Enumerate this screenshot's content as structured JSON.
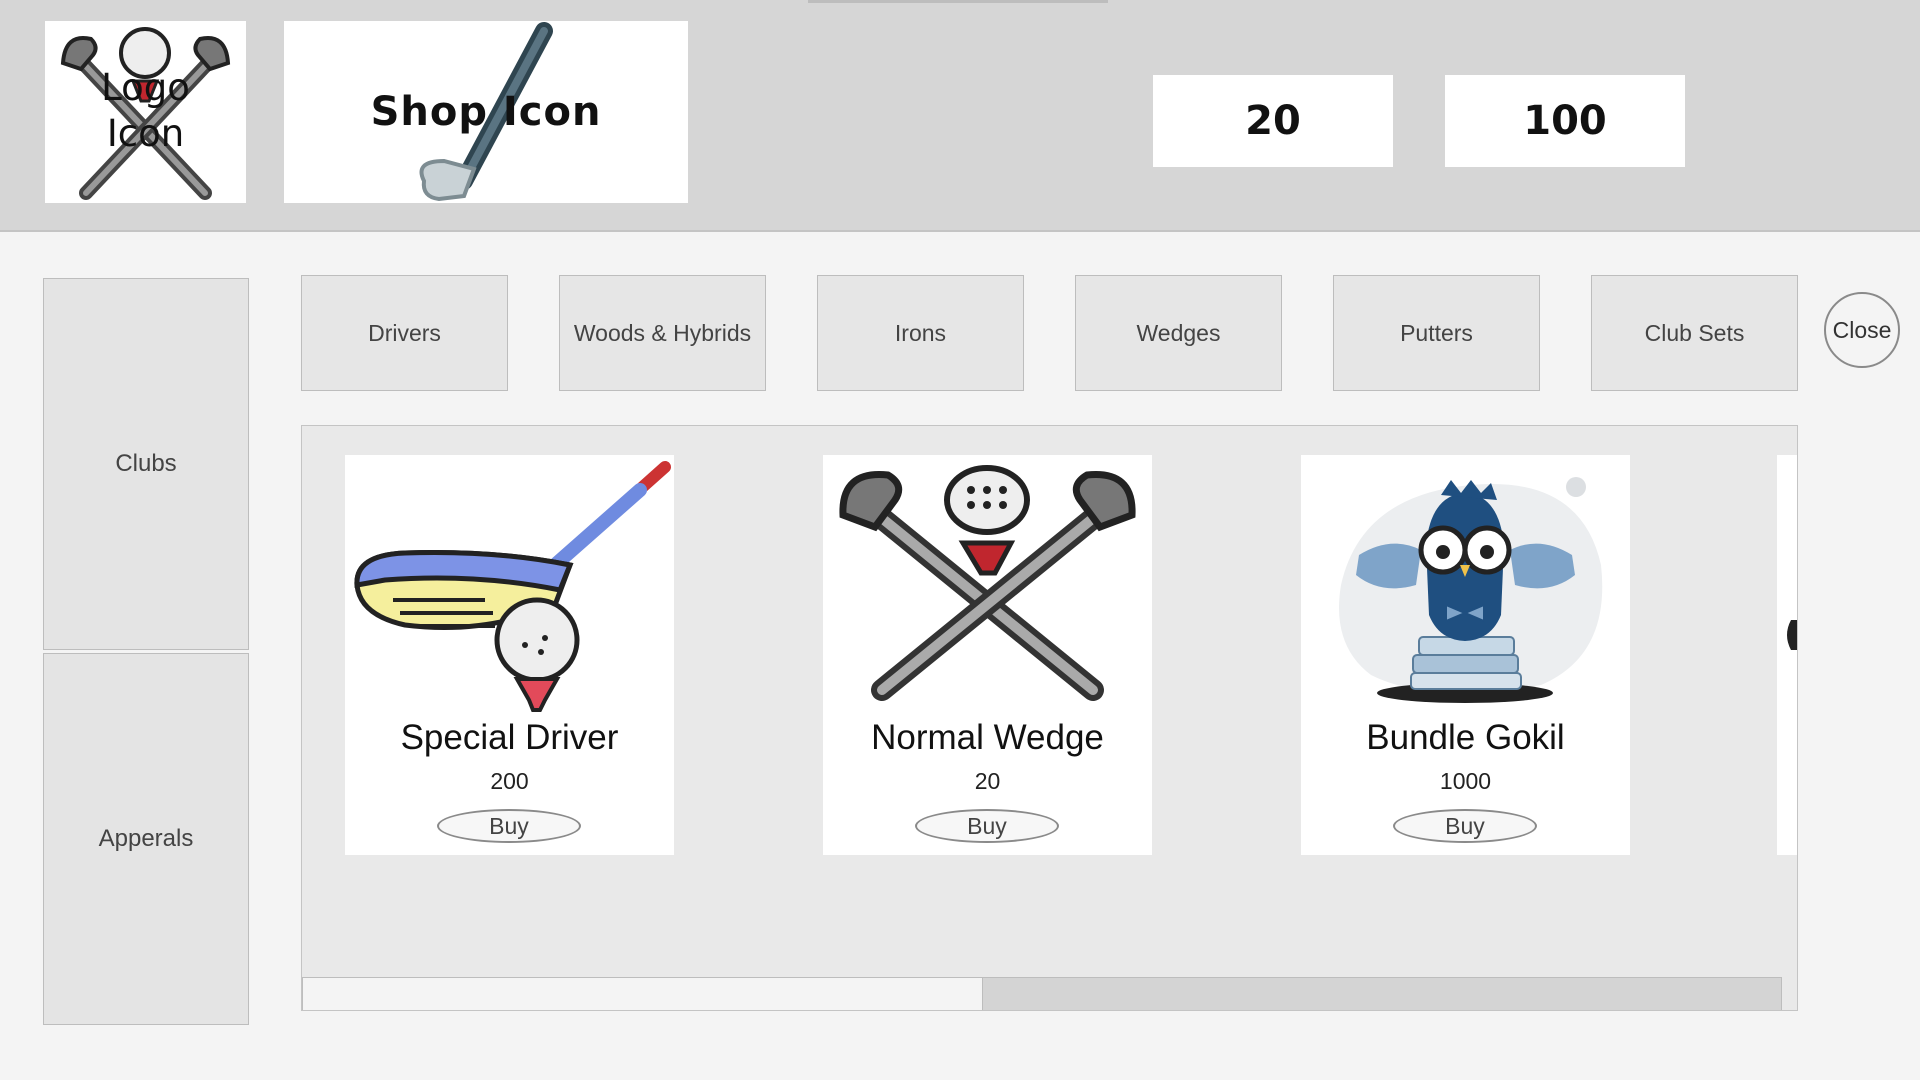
{
  "header": {
    "logo_text": "Logo\nIcon",
    "logo_line1": "Logo",
    "logo_line2": "Icon",
    "shop_text": "Shop Icon",
    "currency_1": "20",
    "currency_2": "100"
  },
  "side_tabs": [
    {
      "label": "Clubs"
    },
    {
      "label": "Apperals"
    }
  ],
  "category_tabs": [
    {
      "label": "Drivers"
    },
    {
      "label": "Woods & Hybrids"
    },
    {
      "label": "Irons"
    },
    {
      "label": "Wedges"
    },
    {
      "label": "Putters"
    },
    {
      "label": "Club Sets"
    }
  ],
  "close_label": "Close",
  "items": [
    {
      "name": "Special Driver",
      "price": "200",
      "buy_label": "Buy",
      "icon": "golf-driver-icon"
    },
    {
      "name": "Normal Wedge",
      "price": "20",
      "buy_label": "Buy",
      "icon": "crossed-clubs-icon"
    },
    {
      "name": "Bundle Gokil",
      "price": "1000",
      "buy_label": "Buy",
      "icon": "owl-books-icon"
    }
  ],
  "scroll": {
    "position_fraction": 0.0,
    "visible_fraction": 0.46
  },
  "colors": {
    "header_bg": "#d6d6d6",
    "page_bg": "#f4f4f4",
    "tab_bg": "#e6e6e6",
    "panel_bg": "#e9e9e9"
  }
}
